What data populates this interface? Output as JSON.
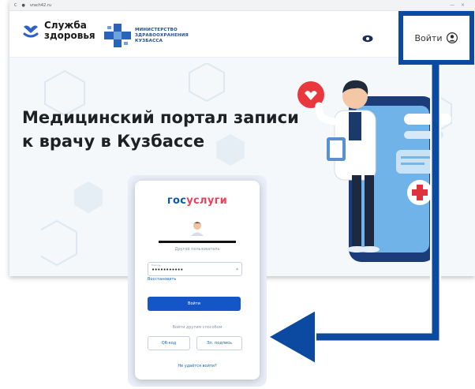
{
  "browser": {
    "url": "vrach42.ru",
    "nav_back": "C",
    "window_controls": "— ×"
  },
  "header": {
    "service_logo_line1": "Служба",
    "service_logo_line2": "здоровья",
    "ministry_line1": "МИНИСТЕРСТВО",
    "ministry_line2": "ЗДРАВООХРАНЕНИЯ",
    "ministry_line3": "КУЗБАССА",
    "login_label": "Войти"
  },
  "hero": {
    "title_line1": "Медицинский портал записи",
    "title_line2": "к врачу в Кузбассе"
  },
  "gosuslugi": {
    "title_gos": "гос",
    "title_uslugi": "услуги",
    "other_user": "Другой пользователь",
    "password_caption": "Пароль",
    "password_value": "•••••••••••",
    "restore": "Восстановить",
    "login_button": "Войти",
    "other_ways": "Войти другим способом",
    "qr_button": "QR-код",
    "signature_button": "Эл. подпись",
    "cant_login": "Не удаётся войти?"
  },
  "colors": {
    "accent_blue": "#0c4aa1",
    "gos_blue": "#0b5aa8",
    "gos_red": "#ee3f58",
    "button_blue": "#1456c8"
  }
}
